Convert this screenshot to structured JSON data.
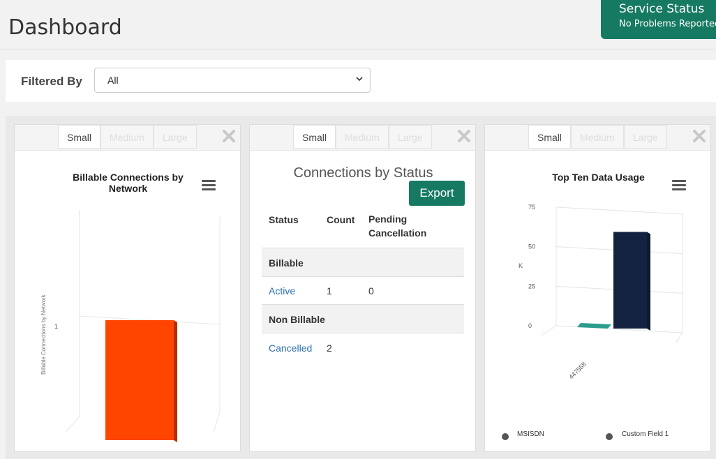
{
  "header": {
    "title": "Dashboard"
  },
  "service": {
    "title": "Service Status",
    "status": "No Problems Reported"
  },
  "filter": {
    "label": "Filtered By",
    "value": "All"
  },
  "panels": [
    {
      "sizes": [
        "Small",
        "Medium",
        "Large"
      ],
      "active_size": "Small"
    },
    {
      "sizes": [
        "Small",
        "Medium",
        "Large"
      ],
      "active_size": "Small"
    },
    {
      "sizes": [
        "Small",
        "Medium",
        "Large"
      ],
      "active_size": "Small"
    }
  ],
  "billable_chart": {
    "title_line1": "Billable Connections by",
    "title_line2": "Network",
    "ylabel": "Billable Connections by Network",
    "tick": "1"
  },
  "status_table": {
    "title": "Connections by Status",
    "export_label": "Export",
    "headers": {
      "status": "Status",
      "count": "Count",
      "pending_line1": "Pending",
      "pending_line2": "Cancellation"
    },
    "groups": [
      {
        "name": "Billable",
        "rows": [
          {
            "status": "Active",
            "count": "1",
            "pending": "0"
          }
        ]
      },
      {
        "name": "Non Billable",
        "rows": [
          {
            "status": "Cancelled",
            "count": "2",
            "pending": ""
          }
        ]
      }
    ]
  },
  "usage_chart": {
    "title": "Top Ten Data Usage",
    "ylabel": "K",
    "ticks": [
      "75",
      "50",
      "25",
      "0"
    ],
    "xlabel": "447558",
    "legend": [
      "MSISDN",
      "Custom Field 1"
    ]
  },
  "chart_data": [
    {
      "type": "bar",
      "title": "Billable Connections by Network",
      "ylabel": "Billable Connections by Network",
      "categories": [
        ""
      ],
      "values": [
        1
      ],
      "colors": [
        "#ff4500"
      ]
    },
    {
      "type": "bar",
      "title": "Top Ten Data Usage",
      "ylabel": "K",
      "ylim": [
        0,
        75
      ],
      "categories": [
        "447558"
      ],
      "series": [
        {
          "name": "MSISDN",
          "values": [
            0
          ]
        },
        {
          "name": "Custom Field 1",
          "values": [
            62
          ]
        }
      ],
      "colors": [
        "#2a9d8f",
        "#13233f"
      ]
    }
  ]
}
